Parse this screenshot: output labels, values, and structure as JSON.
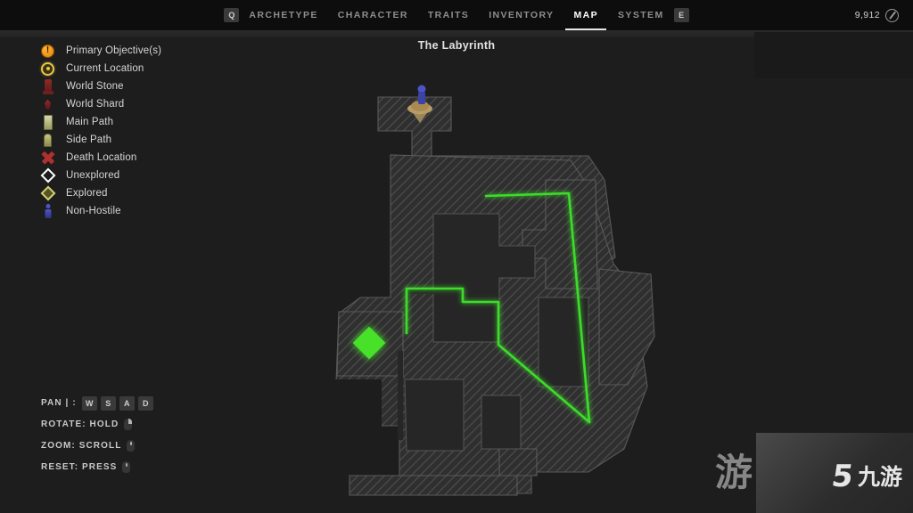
{
  "nav": {
    "left_key": "Q",
    "right_key": "E",
    "tabs": [
      {
        "label": "ARCHETYPE",
        "active": false
      },
      {
        "label": "CHARACTER",
        "active": false
      },
      {
        "label": "TRAITS",
        "active": false
      },
      {
        "label": "INVENTORY",
        "active": false
      },
      {
        "label": "MAP",
        "active": true
      },
      {
        "label": "SYSTEM",
        "active": false
      }
    ],
    "currency": {
      "amount": "9,912",
      "icon": "scrap-coin-icon"
    }
  },
  "map": {
    "title": "The Labyrinth",
    "background_color": "#1d1d1d",
    "region_fill": "#333333",
    "hatch_color": "#4a4a4a",
    "route_color": "#3ddc2a",
    "marker_color": "#46e12b"
  },
  "legend": {
    "items": [
      {
        "label": "Primary Objective(s)",
        "icon": "primary-objective-icon",
        "color": "#e8920c"
      },
      {
        "label": "Current Location",
        "icon": "current-location-icon",
        "color": "#e8c547"
      },
      {
        "label": "World Stone",
        "icon": "world-stone-icon",
        "color": "#8f2a2a"
      },
      {
        "label": "World Shard",
        "icon": "world-shard-icon",
        "color": "#8f2a2a"
      },
      {
        "label": "Main Path",
        "icon": "main-path-icon",
        "color": "#c6c69a"
      },
      {
        "label": "Side Path",
        "icon": "side-path-icon",
        "color": "#b5b56a"
      },
      {
        "label": "Death Location",
        "icon": "death-location-icon",
        "color": "#b03030"
      },
      {
        "label": "Unexplored",
        "icon": "unexplored-diamond-icon",
        "color": "#ffffff"
      },
      {
        "label": "Explored",
        "icon": "explored-diamond-icon",
        "color": "#cfcf7a"
      },
      {
        "label": "Non-Hostile",
        "icon": "non-hostile-icon",
        "color": "#4b55c8"
      }
    ]
  },
  "controls": {
    "pan": {
      "label": "PAN | :",
      "keys": [
        "W",
        "S",
        "A",
        "D"
      ]
    },
    "rotate": {
      "label": "ROTATE: HOLD",
      "icon": "mouse-right-button-icon"
    },
    "zoom": {
      "label": "ZOOM: SCROLL",
      "icon": "mouse-scroll-wheel-icon"
    },
    "reset": {
      "label": "RESET: PRESS",
      "icon": "mouse-middle-button-icon"
    }
  },
  "watermark": {
    "mark": "5",
    "text": "九游",
    "partial": "游"
  }
}
